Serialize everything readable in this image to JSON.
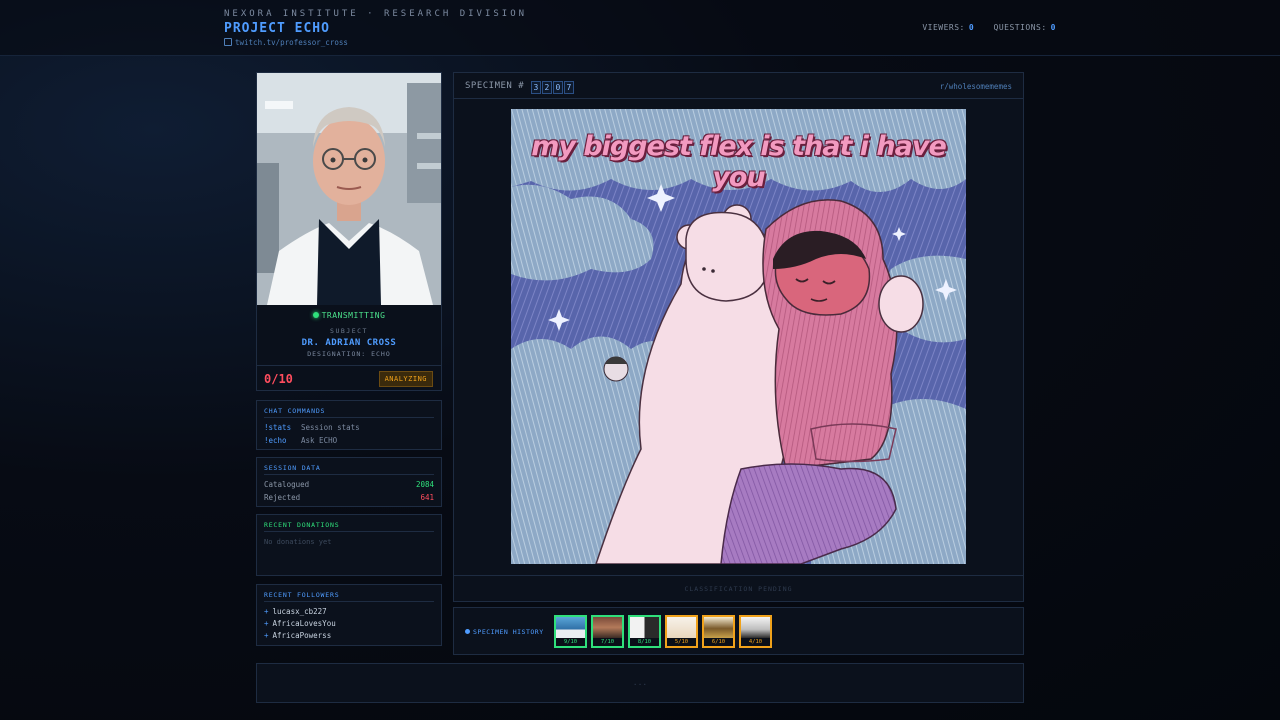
{
  "header": {
    "org": "NEXORA INSTITUTE · RESEARCH DIVISION",
    "title": "PROJECT ECHO",
    "link": "twitch.tv/professor_cross",
    "viewers_label": "VIEWERS:",
    "viewers": "0",
    "questions_label": "QUESTIONS:",
    "questions": "0"
  },
  "subject": {
    "status": "TRANSMITTING",
    "label": "SUBJECT",
    "name": "DR. ADRIAN CROSS",
    "designation": "DESIGNATION: ECHO",
    "score": "0/10",
    "state_badge": "ANALYZING"
  },
  "commands": {
    "title": "CHAT COMMANDS",
    "items": [
      {
        "key": "!stats",
        "desc": "Session stats"
      },
      {
        "key": "!echo",
        "desc": "Ask ECHO"
      }
    ]
  },
  "session": {
    "title": "SESSION DATA",
    "catalogued_label": "Catalogued",
    "catalogued": "2084",
    "rejected_label": "Rejected",
    "rejected": "641"
  },
  "donations": {
    "title": "RECENT DONATIONS",
    "empty": "No donations yet"
  },
  "followers": {
    "title": "RECENT FOLLOWERS",
    "items": [
      "lucasx_cb227",
      "AfricaLovesYou",
      "AfricaPowerss"
    ]
  },
  "specimen": {
    "label": "SPECIMEN #",
    "digits": [
      "3",
      "2",
      "0",
      "7"
    ],
    "subreddit": "r/wholesomememes",
    "caption": "my biggest flex is that i have you",
    "footer": "CLASSIFICATION PENDING"
  },
  "history": {
    "label": "SPECIMEN HISTORY",
    "items": [
      {
        "score": "9/10",
        "status": "good"
      },
      {
        "score": "7/10",
        "status": "good"
      },
      {
        "score": "8/10",
        "status": "good"
      },
      {
        "score": "5/10",
        "status": "mid"
      },
      {
        "score": "6/10",
        "status": "mid"
      },
      {
        "score": "4/10",
        "status": "mid"
      }
    ]
  },
  "bottom": {
    "text": "..."
  },
  "colors": {
    "accent": "#4f9cff",
    "good": "#2fe07b",
    "mid": "#f0a21b",
    "bad": "#ff4d5e"
  }
}
